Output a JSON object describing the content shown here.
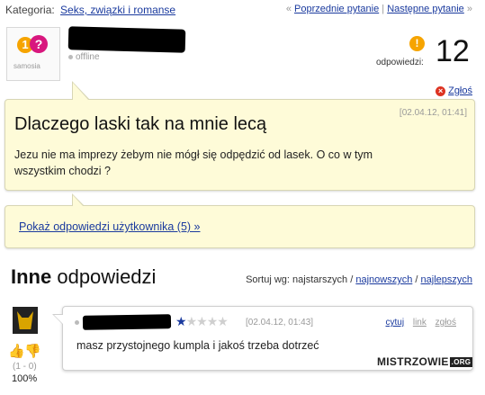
{
  "category": {
    "label": "Kategoria:",
    "value": "Seks, związki i romanse"
  },
  "nav": {
    "prev_arrow": "«",
    "prev": "Poprzednie pytanie",
    "sep": "|",
    "next": "Następne pytanie",
    "next_arrow": "»"
  },
  "asker": {
    "status": "offline",
    "logo": "samosia"
  },
  "answers_count": {
    "label": "odpowiedzi:",
    "value": "12"
  },
  "report": {
    "label": "Zgłoś"
  },
  "question": {
    "title": "Dlaczego laski tak na mnie lecą",
    "date": "[02.04.12, 01:41]",
    "body": "Jezu nie ma imprezy żebym nie mógł się odpędzić od lasek. O co w tym wszystkim chodzi ?"
  },
  "show_user_answers": {
    "label": "Pokaż odpowiedzi użytkownika (5) »"
  },
  "other_answers": {
    "title_bold": "Inne",
    "title_rest": " odpowiedzi"
  },
  "sort": {
    "label": "Sortuj wg: najstarszych /",
    "opt_newest": "najnowszych",
    "sep": "/",
    "opt_best": "najlepszych"
  },
  "answer": {
    "rating": 1,
    "rating_max": 5,
    "date": "[02.04.12, 01:43]",
    "actions": [
      "cytuj",
      "link",
      "zgłoś"
    ],
    "text": "masz przystojnego kumpla i jakoś trzeba dotrzeć",
    "votes": "(1 - 0)",
    "percent": "100%"
  },
  "watermark": {
    "text": "MISTRZOWIE",
    "suffix": ".ORG"
  }
}
